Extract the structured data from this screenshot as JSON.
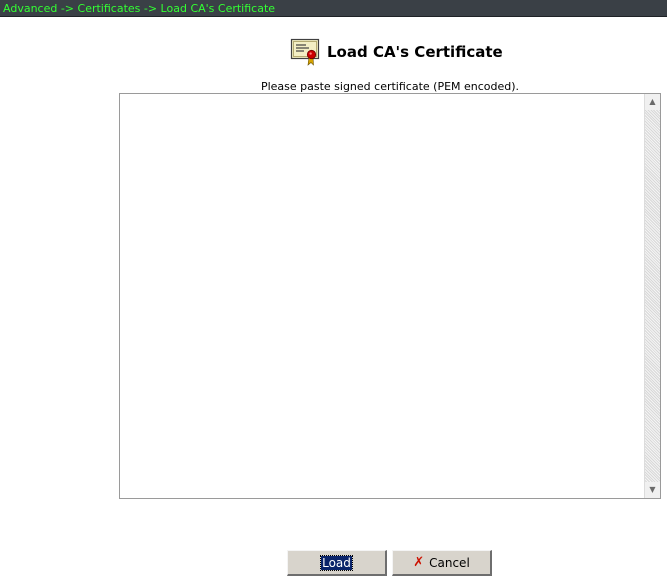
{
  "breadcrumb": {
    "text": "Advanced -> Certificates -> Load CA's Certificate"
  },
  "page": {
    "title": "Load CA's Certificate",
    "icon": "certificate-icon",
    "instructions": "Please paste signed certificate (PEM encoded)."
  },
  "certificate_input": {
    "value": "",
    "placeholder": ""
  },
  "buttons": {
    "load_label": "Load",
    "cancel_label": "Cancel",
    "cancel_icon": "x-icon"
  },
  "colors": {
    "breadcrumb_bg": "#3a4046",
    "breadcrumb_text": "#33ff33",
    "cancel_icon": "#cc1100",
    "focus_highlight": "#0a246a"
  }
}
